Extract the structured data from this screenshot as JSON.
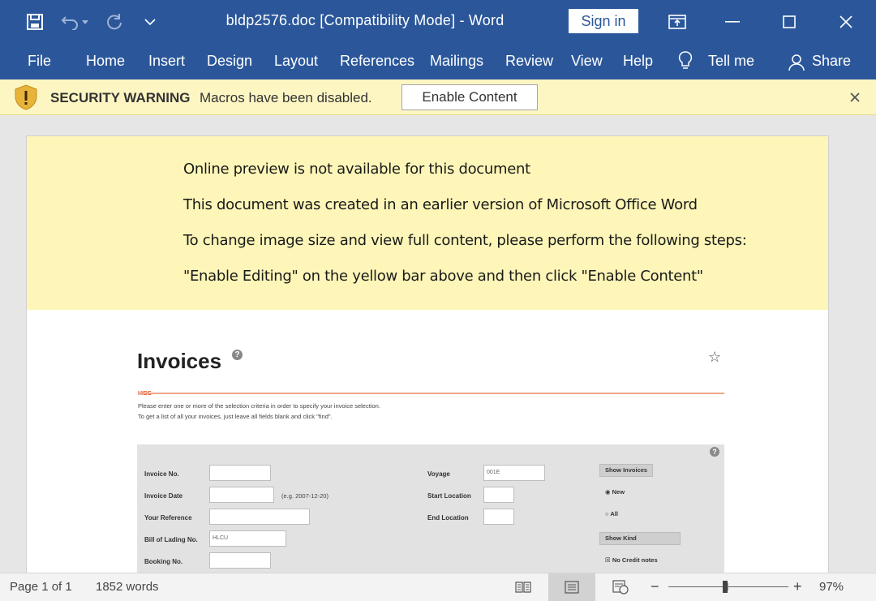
{
  "titlebar": {
    "title": "bldp2576.doc [Compatibility Mode]  -  Word",
    "sign_in": "Sign in",
    "icons": [
      "save-icon",
      "undo-icon",
      "dropdown-icon",
      "redo-icon",
      "customize-icon",
      "ribbon-display-icon",
      "minimize-icon",
      "maximize-icon",
      "close-icon"
    ]
  },
  "ribbon": {
    "tabs": [
      "File",
      "Home",
      "Insert",
      "Design",
      "Layout",
      "References",
      "Mailings",
      "Review",
      "View",
      "Help"
    ],
    "tell_me": "Tell me",
    "share": "Share"
  },
  "security_bar": {
    "title": "SECURITY WARNING",
    "message": "Macros have been disabled.",
    "button": "Enable Content"
  },
  "document": {
    "lines": [
      "Online preview is not available for this document",
      "This document was created in an earlier version of Microsoft Office Word",
      "To change image size and view full content, please perform the following steps:",
      "\"Enable Editing\" on the yellow bar above and then click \"Enable Content\""
    ],
    "invoice": {
      "title": "Invoices",
      "hide": "HIDE",
      "note1": "Please enter one or more of the selection criteria in order to specify your invoice selection.",
      "note2": "To get a list of all your invoices, just leave all fields blank and click \"find\".",
      "fields": {
        "invoice_no": "Invoice No.",
        "invoice_date": "Invoice Date",
        "date_hint": "(e.g. 2007-12-20)",
        "your_reference": "Your Reference",
        "bill_of_lading": "Bill of Lading No.",
        "bill_value": "HLCU",
        "booking_no": "Booking No.",
        "voyage": "Voyage",
        "voyage_value": "001E",
        "start_location": "Start Location",
        "end_location": "End Location",
        "show_invoices": "Show Invoices",
        "new": "New",
        "all": "All",
        "show_kind": "Show Kind",
        "no_credit_notes": "No Credit notes"
      }
    }
  },
  "statusbar": {
    "page": "Page 1 of 1",
    "words": "1852 words",
    "zoom": "97%",
    "zoom_level": 0.47
  }
}
